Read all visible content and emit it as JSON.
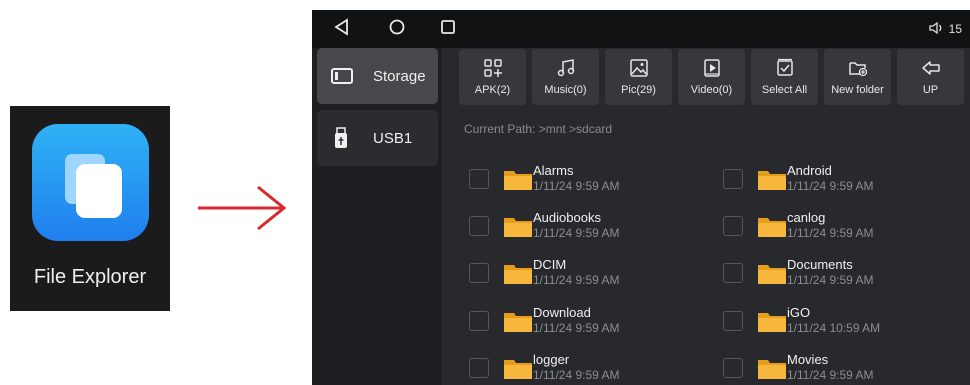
{
  "app": {
    "label": "File Explorer",
    "icon": "folder-icon"
  },
  "arrow": {
    "color": "#d62b2b"
  },
  "statusbar": {
    "nav": [
      "back-icon",
      "home-icon",
      "recents-icon"
    ],
    "volume_icon": "volume-icon",
    "volume": "15"
  },
  "sidebar": {
    "items": [
      {
        "label": "Storage",
        "icon": "storage-icon",
        "active": true
      },
      {
        "label": "USB1",
        "icon": "usb-icon",
        "active": false
      }
    ]
  },
  "toolbar": {
    "buttons": [
      {
        "label": "APK(2)",
        "icon": "apk-icon"
      },
      {
        "label": "Music(0)",
        "icon": "music-icon"
      },
      {
        "label": "Pic(29)",
        "icon": "picture-icon"
      },
      {
        "label": "Video(0)",
        "icon": "video-icon"
      },
      {
        "label": "Select All",
        "icon": "select-all-icon"
      },
      {
        "label": "New folder",
        "icon": "new-folder-icon"
      },
      {
        "label": "UP",
        "icon": "up-arrow-icon"
      }
    ]
  },
  "path": "Current Path:  >mnt >sdcard",
  "files": [
    {
      "name": "Alarms",
      "date": "1/11/24 9:59 AM"
    },
    {
      "name": "Android",
      "date": "1/11/24 9:59 AM"
    },
    {
      "name": "Audiobooks",
      "date": "1/11/24 9:59 AM"
    },
    {
      "name": "canlog",
      "date": "1/11/24 9:59 AM"
    },
    {
      "name": "DCIM",
      "date": "1/11/24 9:59 AM"
    },
    {
      "name": "Documents",
      "date": "1/11/24 9:59 AM"
    },
    {
      "name": "Download",
      "date": "1/11/24 9:59 AM"
    },
    {
      "name": "iGO",
      "date": "1/11/24 10:59 AM"
    },
    {
      "name": "logger",
      "date": "1/11/24 9:59 AM"
    },
    {
      "name": "Movies",
      "date": "1/11/24 9:59 AM"
    }
  ],
  "colors": {
    "folder": "#f6b73c",
    "folder_tab": "#e59d1e",
    "accent_icon": "#2a8cf2"
  }
}
